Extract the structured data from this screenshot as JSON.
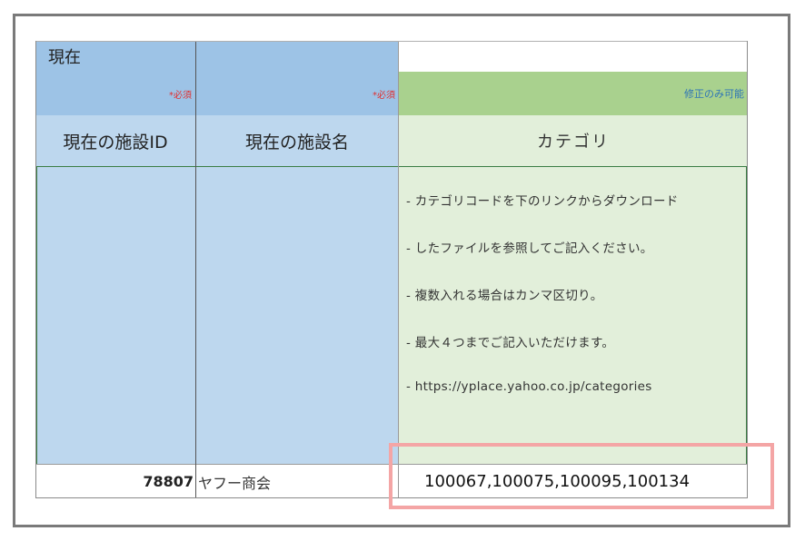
{
  "sheet": {
    "group_label": "現在",
    "required_mark": "*必須",
    "editable_mark": "修正のみ可能",
    "columns": {
      "facility_id": "現在の施設ID",
      "facility_name": "現在の施設名",
      "category": "カテゴリ"
    },
    "notes": [
      "- カテゴリコードを下のリンクからダウンロード",
      "- したファイルを参照してご記入ください。",
      "- 複数入れる場合はカンマ区切り。",
      "- 最大４つまでご記入いただけます。",
      "- https://yplace.yahoo.co.jp/categories"
    ],
    "row": {
      "facility_id": "78807",
      "facility_name": "ヤフー商会",
      "category": "100067,100075,100095,100134"
    }
  },
  "colors": {
    "header_blue": "#9dc3e6",
    "body_blue": "#bdd7ee",
    "header_green": "#a9d18e",
    "body_green": "#e2efda",
    "highlight": "#f4a5a5",
    "required_red": "#e03030",
    "editable_blue": "#2e75b6"
  }
}
